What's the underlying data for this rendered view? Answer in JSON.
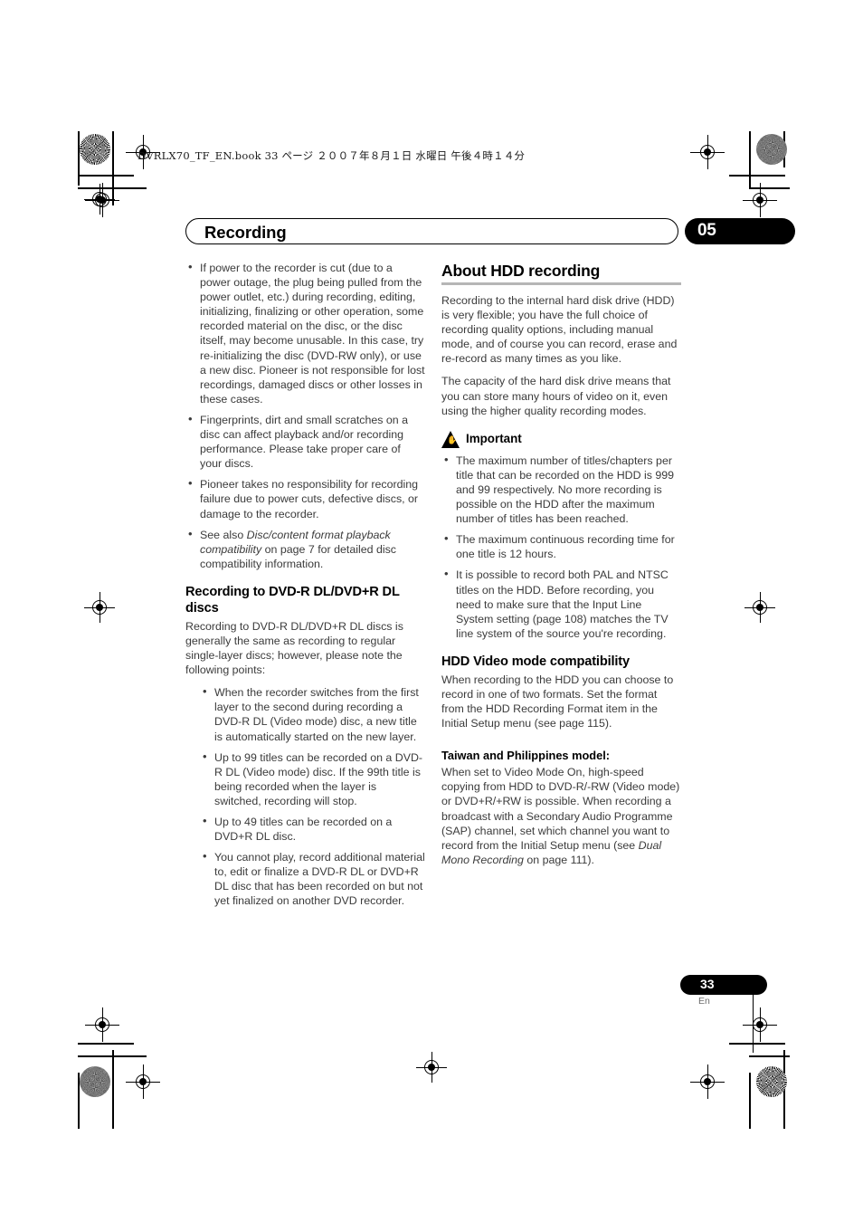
{
  "print_header": {
    "filecode": "DVRLX70_TF_EN.book  33 ページ  ２００７年８月１日  水曜日  午後４時１４分"
  },
  "chapter": {
    "title": "Recording",
    "number": "05"
  },
  "left_column": {
    "notes": [
      "If power to the recorder is cut (due to a power outage, the plug being pulled from the power outlet, etc.) during recording, editing, initializing, finalizing or other operation, some recorded material on the disc, or the disc itself, may become unusable. In this case, try re-initializing the disc (DVD-RW only), or use a new disc. Pioneer is not responsible for lost recordings, damaged discs or other losses in these cases.",
      "Fingerprints, dirt and small scratches on a disc can affect playback and/or recording performance. Please take proper care of your discs.",
      "Pioneer takes no responsibility for recording failure due to power cuts, defective discs, or damage to the recorder."
    ],
    "see_also": {
      "lead": "See also ",
      "italic": "Disc/content format playback compatibility",
      "tail": " on page 7 for detailed disc compatibility information."
    },
    "dl_heading": "Recording to DVD-R DL/DVD+R DL discs",
    "dl_intro": "Recording to DVD-R DL/DVD+R DL discs is generally the same as recording to regular single-layer discs; however, please note the following points:",
    "dl_bullets": [
      "When the recorder switches from the first layer to the second during recording a DVD-R DL (Video mode) disc, a new title is automatically started on the new layer.",
      "Up to 99 titles can be recorded on a DVD-R DL (Video mode) disc. If the 99th title is being recorded when the layer is switched, recording will stop.",
      "Up to 49 titles can be recorded on a DVD+R DL disc.",
      "You cannot play, record additional material to, edit or finalize a DVD-R DL or DVD+R DL disc that has been recorded on but not yet finalized on another DVD recorder."
    ]
  },
  "right_column": {
    "hdd_heading": "About HDD recording",
    "hdd_paragraphs": [
      "Recording to the internal hard disk drive (HDD) is very flexible; you have the full choice of recording quality options, including manual mode, and of course you can record, erase and re-record as many times as you like.",
      "The capacity of the hard disk drive means that you can store many hours of video on it, even using the higher quality recording modes."
    ],
    "important": {
      "label": "Important",
      "icon": "warning-triangle-icon",
      "bullets": [
        "The maximum number of titles/chapters per title that can be recorded on the HDD is 999 and 99 respectively. No more recording is possible on the HDD after the maximum number of titles has been reached.",
        "The maximum continuous recording time for one title is 12 hours.",
        "It is possible to record both PAL and NTSC titles on the HDD. Before recording, you need to make sure that the Input Line System setting (page 108) matches the TV line system of the source you're recording."
      ]
    },
    "video_mode_heading": "HDD Video mode compatibility",
    "video_mode_text": "When recording to the HDD you can choose to record in one of two formats. Set the format from the HDD Recording Format item in the Initial Setup menu (see page 115).",
    "taiwan_heading": "Taiwan and Philippines model:",
    "taiwan_text": {
      "lead": "When set to Video Mode On, high-speed copying from HDD to DVD-R/-RW (Video mode) or DVD+R/+RW is possible. When recording a broadcast with a Secondary Audio Programme (SAP) channel, set which channel you want to record from the Initial Setup menu (see ",
      "italic": "Dual Mono Recording",
      "tail": " on page 111)."
    }
  },
  "footer": {
    "page_number": "33",
    "language": "En"
  }
}
